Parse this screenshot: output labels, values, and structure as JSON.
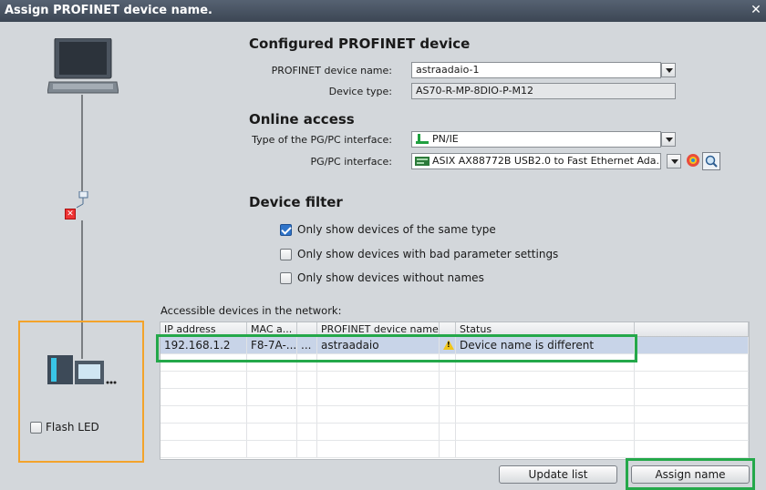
{
  "window": {
    "title": "Assign PROFINET device name.",
    "close_glyph": "✕"
  },
  "configured": {
    "heading": "Configured PROFINET device",
    "name_label": "PROFINET device name:",
    "name_value": "astraadaio-1",
    "type_label": "Device type:",
    "type_value": "AS70-R-MP-8DIO-P-M12"
  },
  "online": {
    "heading": "Online access",
    "iface_type_label": "Type of the PG/PC interface:",
    "iface_type_value": "PN/IE",
    "iface_label": "PG/PC interface:",
    "iface_value": "ASIX AX88772B USB2.0 to Fast Ethernet Ada..."
  },
  "filter": {
    "heading": "Device filter",
    "options": [
      {
        "label": "Only show devices of the same type",
        "checked": true
      },
      {
        "label": "Only show devices with bad parameter settings",
        "checked": false
      },
      {
        "label": "Only show devices without names",
        "checked": false
      }
    ]
  },
  "table": {
    "caption": "Accessible devices in the network:",
    "headers": [
      "IP address",
      "MAC a...",
      "",
      "PROFINET device name",
      "",
      "Status"
    ],
    "rows": [
      {
        "ip": "192.168.1.2",
        "mac": "F8-7A-...",
        "more": "...",
        "name": "astraadaio",
        "status": "Device name is different"
      }
    ]
  },
  "left_panel": {
    "flash_led_label": "Flash LED"
  },
  "buttons": {
    "update_list": "Update list",
    "assign_name": "Assign name"
  },
  "colors": {
    "highlight_green": "#24a84a",
    "highlight_orange": "#f3a32b"
  }
}
